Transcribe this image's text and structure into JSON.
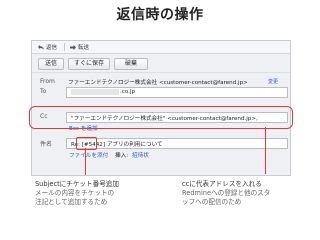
{
  "title": "返信時の操作",
  "tabs": {
    "reply": "返信",
    "forward": "転送"
  },
  "buttons": {
    "send": "送信",
    "send_now": "すぐに保存",
    "discard": "破棄"
  },
  "from": {
    "label": "From",
    "value": "ファーエンドテクノロジー株式会社 <customer-contact@farend.jp>",
    "change_link": "変更"
  },
  "to": {
    "label": "To",
    "value": ".co.jp"
  },
  "cc": {
    "label": "Cc",
    "value": "\"ファーエンドテクノロジー株式会社\" <customer-contact@farend.jp>,",
    "add_bcc": "Bcc を追加"
  },
  "subject": {
    "label": "件名",
    "prefix": "Re: ",
    "ticket": "[#5442]",
    "rest": " アプリの利用について"
  },
  "attach": {
    "file": "ファイルを添付",
    "insert_label": "挿入:",
    "invite": "招待状"
  },
  "caption_left": {
    "heading": "Subjectにチケット番号追加",
    "line1": "メールの内容をチケットの",
    "line2": "注記として追加するため"
  },
  "caption_right": {
    "heading": "ccに代表アドレスを入れる",
    "line1": "Redmineへの登録と他のスタ",
    "line2": "ッフへの配信のため"
  },
  "colors": {
    "accent": "#e0393a",
    "link": "#2b5bb5"
  }
}
